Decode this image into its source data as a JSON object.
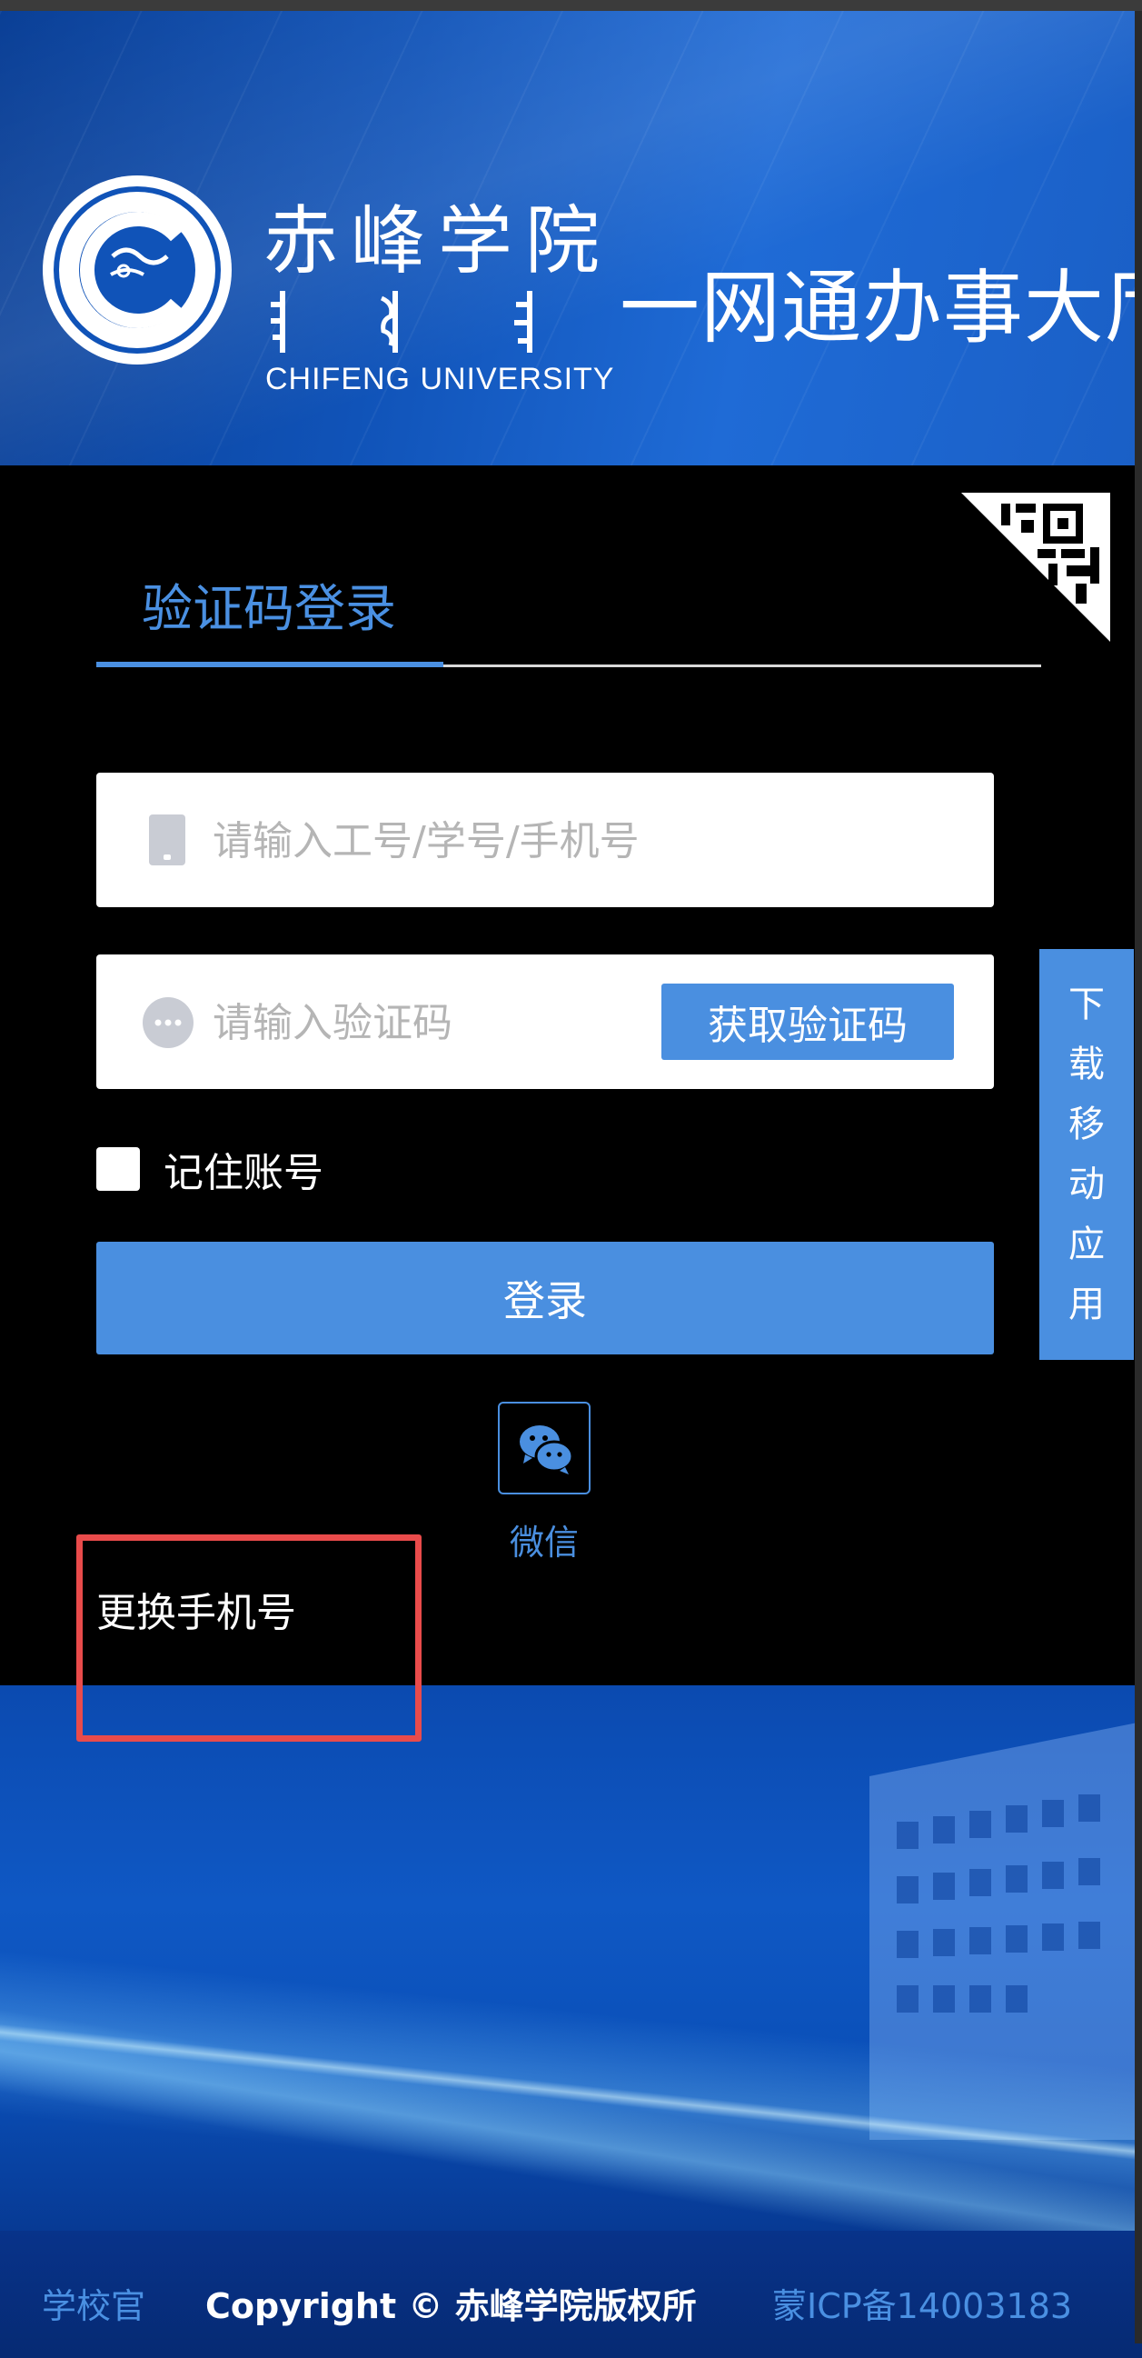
{
  "header": {
    "logo_cn": "赤峰学院",
    "logo_en": "CHIFENG UNIVERSITY",
    "hall_title": "一网通办事大厅"
  },
  "login": {
    "tab_label": "验证码登录",
    "account_placeholder": "请输入工号/学号/手机号",
    "code_placeholder": "请输入验证码",
    "get_code_label": "获取验证码",
    "remember_label": "记住账号",
    "login_label": "登录",
    "wechat_label": "微信",
    "change_phone_label": "更换手机号"
  },
  "side_download": {
    "chars": [
      "下",
      "载",
      "移",
      "动",
      "应",
      "用"
    ]
  },
  "footer": {
    "school_link": "学校官",
    "copyright": "Copyright © 赤峰学院版权所",
    "icp": "蒙ICP备14003183"
  },
  "colors": {
    "accent": "#4a8fe0",
    "panel_bg": "#000000",
    "highlight": "#e94b4b",
    "header_bg": "#1053b8"
  },
  "icons": {
    "phone": "phone-icon",
    "chat": "chat-bubble-icon",
    "wechat": "wechat-icon",
    "qr": "qr-code-icon",
    "logo": "university-seal-icon"
  }
}
